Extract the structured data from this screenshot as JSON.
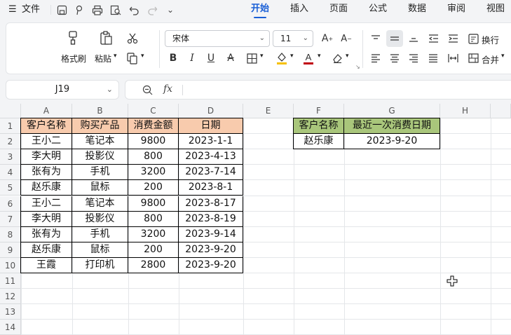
{
  "menubar": {
    "file_label": "文件",
    "tabs": [
      "开始",
      "插入",
      "页面",
      "公式",
      "数据",
      "审阅",
      "视图"
    ],
    "active_tab": "开始"
  },
  "ribbon": {
    "format_painter": "格式刷",
    "paste": "粘贴",
    "font_name": "宋体",
    "font_size": "11",
    "wrap": "换行",
    "merge": "合并"
  },
  "formula_bar": {
    "name_box": "J19",
    "fx": "fx",
    "value": ""
  },
  "grid": {
    "columns": [
      "A",
      "B",
      "C",
      "D",
      "E",
      "F",
      "G",
      "H"
    ],
    "rows": [
      "1",
      "2",
      "3",
      "4",
      "5",
      "6",
      "7",
      "8",
      "9",
      "10",
      "11",
      "12",
      "13",
      "14"
    ],
    "table1": {
      "headers": [
        "客户名称",
        "购买产品",
        "消费金额",
        "日期"
      ],
      "rows": [
        [
          "王小二",
          "笔记本",
          "9800",
          "2023-1-1"
        ],
        [
          "李大明",
          "投影仪",
          "800",
          "2023-4-13"
        ],
        [
          "张有为",
          "手机",
          "3200",
          "2023-7-14"
        ],
        [
          "赵乐康",
          "鼠标",
          "200",
          "2023-8-1"
        ],
        [
          "王小二",
          "笔记本",
          "9800",
          "2023-8-17"
        ],
        [
          "李大明",
          "投影仪",
          "800",
          "2023-8-19"
        ],
        [
          "张有为",
          "手机",
          "3200",
          "2023-9-14"
        ],
        [
          "赵乐康",
          "鼠标",
          "200",
          "2023-9-20"
        ],
        [
          "王霞",
          "打印机",
          "2800",
          "2023-9-20"
        ]
      ]
    },
    "table2": {
      "headers": [
        "客户名称",
        "最近一次消费日期"
      ],
      "rows": [
        [
          "赵乐康",
          "2023-9-20"
        ]
      ]
    }
  },
  "colors": {
    "accent": "#1a5fd6",
    "header_orange": "#f8cbad",
    "header_green": "#a9c67b"
  }
}
